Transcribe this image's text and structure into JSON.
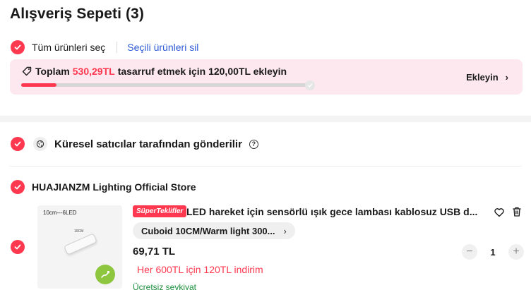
{
  "header": {
    "title": "Alışveriş Sepeti (3)"
  },
  "selection": {
    "select_all_label": "Tüm ürünleri seç",
    "delete_selected_label": "Seçili ürünleri sil"
  },
  "promo": {
    "prefix": "Toplam",
    "amount": "530,29TL",
    "suffix": "tasarruf etmek için 120,00TL ekleyin",
    "add_label": "Ekleyin",
    "progress_fraction": 0.12,
    "accent_color": "#fd384f",
    "background_color": "#fce8ee"
  },
  "shipping_group": {
    "label": "Küresel satıcılar tarafından gönderilir",
    "icon": "globe-icon",
    "help_icon": "question-icon"
  },
  "store": {
    "name": "HUAJIANZM Lighting Official Store"
  },
  "item": {
    "image_caption": "10cm---6LED",
    "image_dim": "10CM",
    "badge": "SüperTeklifler",
    "title": "LED hareket için sensörlü ışık gece lambası kablosuz USB d...",
    "variant": "Cuboid 10CM/Warm light 300...",
    "price": "69,71 TL",
    "discount": "Her 600TL için 120TL indirim",
    "shipping": "Ücretsiz sevkiyat",
    "quantity": "1",
    "discount_color": "#fd384f",
    "shipping_color": "#1c8f3c"
  }
}
